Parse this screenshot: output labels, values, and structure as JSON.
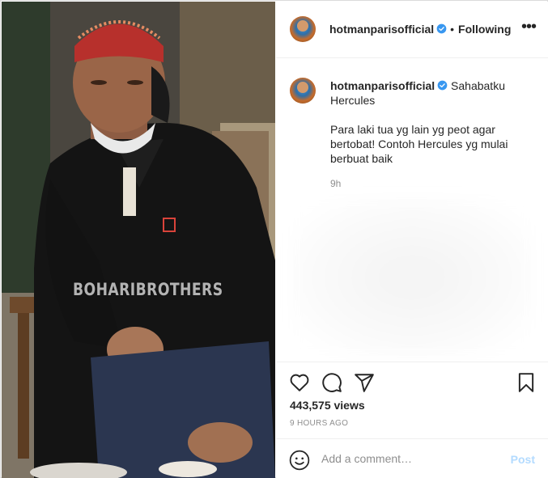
{
  "post": {
    "media": {
      "watermark": "BOHARIBROTHERS"
    },
    "header": {
      "username": "hotmanparisofficial",
      "verified": true,
      "separator": "•",
      "follow_status": "Following",
      "more_label": "•••"
    },
    "caption": {
      "username": "hotmanparisofficial",
      "line1": "Sahabatku",
      "line2": "Hercules",
      "body": "Para laki tua yg lain yg peot agar bertobat! Contoh Hercules yg mulai berbuat baik",
      "time": "9h"
    },
    "actions": {
      "icons": [
        "heart-icon",
        "comment-icon",
        "share-icon",
        "bookmark-icon"
      ]
    },
    "views": "443,575 views",
    "ago": "9 HOURS AGO",
    "comment": {
      "placeholder": "Add a comment…",
      "post_label": "Post"
    },
    "colors": {
      "verified_blue": "#3897f0",
      "post_button_disabled": "#b3dbff",
      "secondary_text": "#8e8e8e"
    }
  }
}
